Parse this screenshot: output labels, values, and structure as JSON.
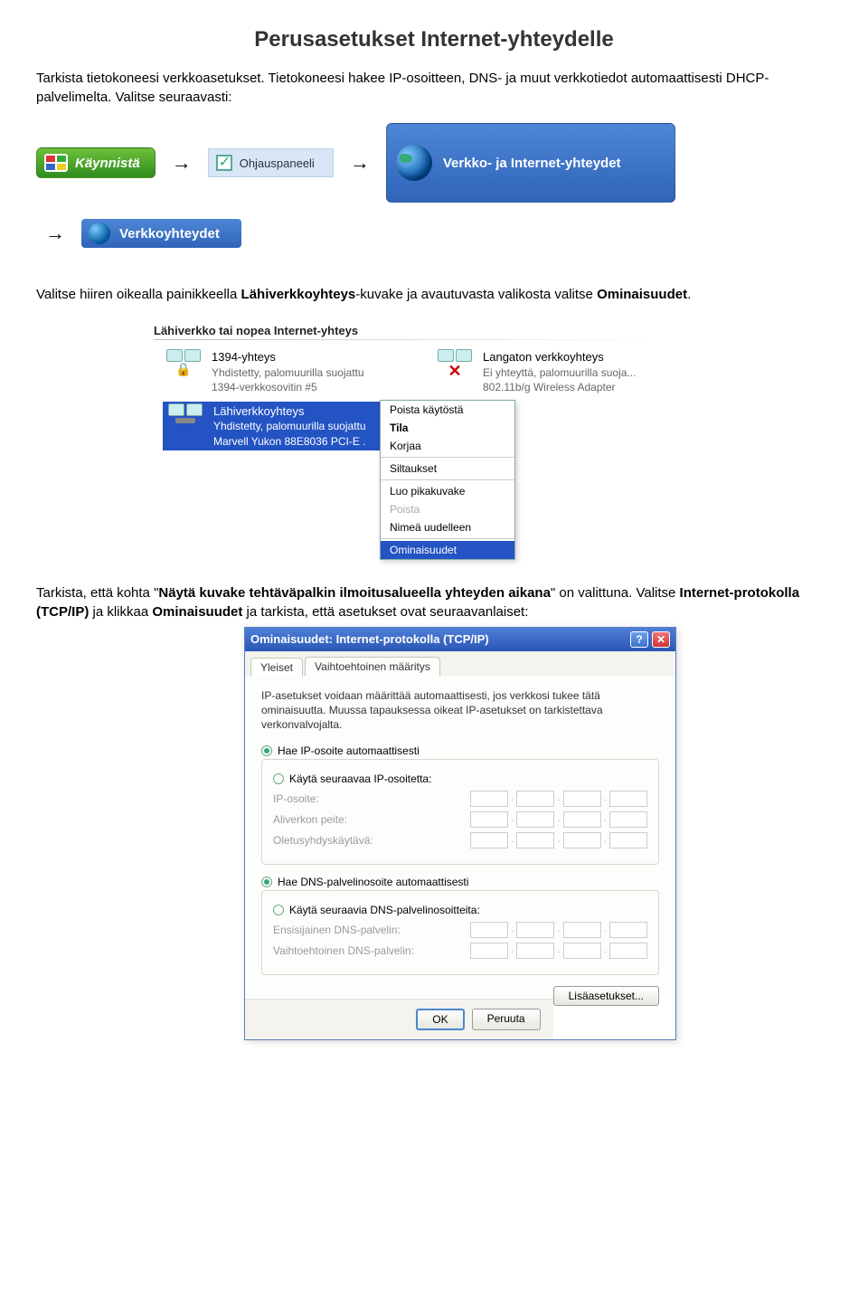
{
  "title": "Perusasetukset Internet-yhteydelle",
  "intro1": "Tarkista tietokoneesi verkkoasetukset. Tietokoneesi hakee IP-osoitteen, DNS- ja muut verkkotiedot automaattisesti DHCP-palvelimelta. Valitse seuraavasti:",
  "nav": {
    "start": "Käynnistä",
    "ohjaus": "Ohjauspaneeli",
    "verkkoInternet": "Verkko- ja Internet-yhteydet",
    "verkkoyhteydet": "Verkkoyhteydet"
  },
  "para2a": "Valitse hiiren oikealla painikkeella ",
  "para2b": "Lähiverkkoyhteys",
  "para2c": "-kuvake ja avautuvasta valikosta valitse ",
  "para2d": "Ominaisuudet",
  "para2e": ".",
  "connHeader": "Lähiverkko tai nopea Internet-yhteys",
  "conn1": {
    "name": "1394-yhteys",
    "l1": "Yhdistetty, palomuurilla suojattu",
    "l2": "1394-verkkosovitin #5"
  },
  "conn2": {
    "name": "Langaton verkkoyhteys",
    "l1": "Ei yhteyttä, palomuurilla suoja...",
    "l2": "802.11b/g Wireless Adapter"
  },
  "conn3": {
    "name": "Lähiverkkoyhteys",
    "l1": "Yhdistetty, palomuurilla suojattu",
    "l2": "Marvell Yukon 88E8036 PCI-E ."
  },
  "ctx": {
    "poistaK": "Poista käytöstä",
    "tila": "Tila",
    "korjaa": "Korjaa",
    "siltaukset": "Siltaukset",
    "luo": "Luo pikakuvake",
    "poista": "Poista",
    "nimea": "Nimeä uudelleen",
    "omin": "Ominaisuudet"
  },
  "para3a": "Tarkista, että kohta \"",
  "para3b": "Näytä kuvake tehtäväpalkin ilmoitusalueella yhteyden aikana",
  "para3c": "\" on valittuna. Valitse ",
  "para3d": "Internet-protokolla (TCP/IP)",
  "para3e": " ja klikkaa ",
  "para3f": "Ominaisuudet",
  "para3g": " ja tarkista, että asetukset ovat seuraavanlaiset:",
  "dlg": {
    "title": "Ominaisuudet: Internet-protokolla (TCP/IP)",
    "tab1": "Yleiset",
    "tab2": "Vaihtoehtoinen määritys",
    "desc": "IP-asetukset voidaan määrittää automaattisesti, jos verkkosi tukee tätä ominaisuutta. Muussa tapauksessa oikeat IP-asetukset on tarkistettava verkonvalvojalta.",
    "rIpAuto": "Hae IP-osoite automaattisesti",
    "rIpMan": "Käytä seuraavaa IP-osoitetta:",
    "fIp": "IP-osoite:",
    "fMask": "Aliverkon peite:",
    "fGw": "Oletusyhdyskäytävä:",
    "rDnsAuto": "Hae DNS-palvelinosoite automaattisesti",
    "rDnsMan": "Käytä seuraavia DNS-palvelinosoitteita:",
    "fDns1": "Ensisijainen DNS-palvelin:",
    "fDns2": "Vaihtoehtoinen DNS-palvelin:",
    "adv": "Lisäasetukset...",
    "ok": "OK",
    "cancel": "Peruuta"
  }
}
